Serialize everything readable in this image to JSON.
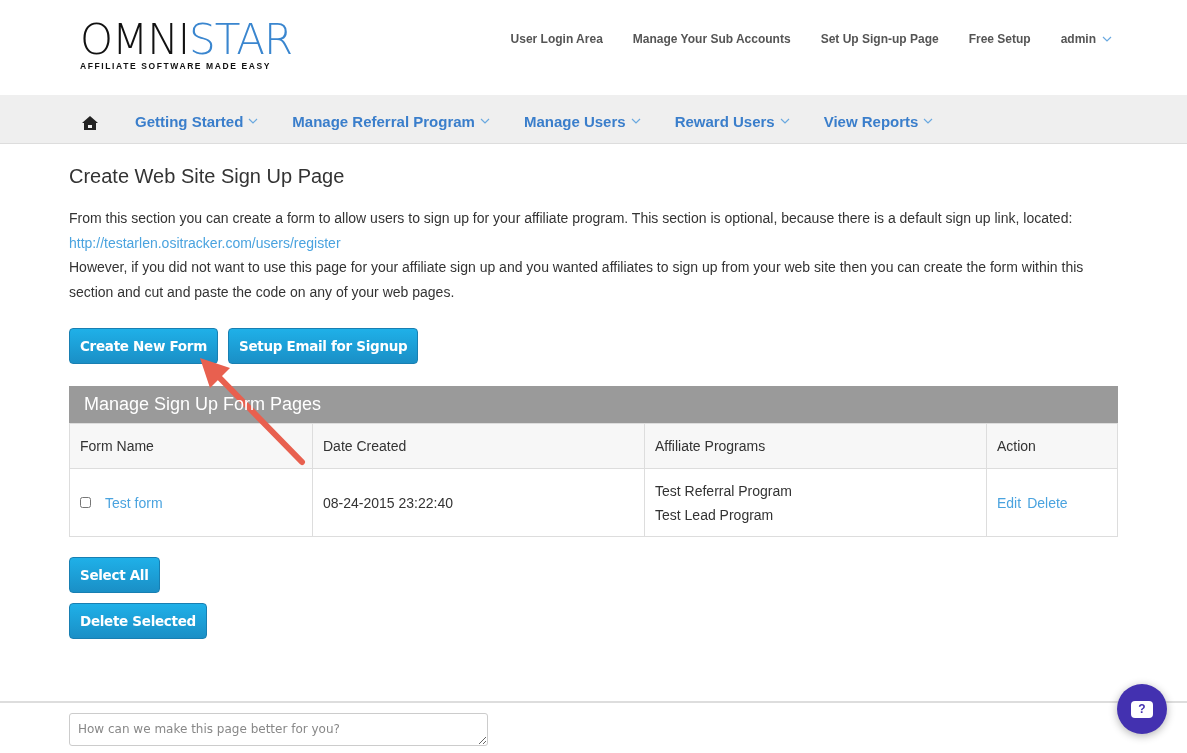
{
  "logo": {
    "word_start": "OMNI",
    "word_end": "STAR",
    "tagline": "AFFILIATE SOFTWARE MADE EASY"
  },
  "top_links": [
    {
      "label": "User Login Area",
      "dropdown": false
    },
    {
      "label": "Manage Your Sub Accounts",
      "dropdown": false
    },
    {
      "label": "Set Up Sign-up Page",
      "dropdown": false
    },
    {
      "label": "Free Setup",
      "dropdown": false
    },
    {
      "label": "admin",
      "dropdown": true
    }
  ],
  "nav": [
    "Getting Started",
    "Manage Referral Program",
    "Manage Users",
    "Reward Users",
    "View Reports"
  ],
  "page_title": "Create Web Site Sign Up Page",
  "intro": {
    "text_before": "From this section you can create a form to allow users to sign up for your affiliate program. This section is optional, because there is a default sign up link, located:",
    "link": "http://testarlen.ositracker.com/users/register",
    "text_after": "However, if you did not want to use this page for your affiliate sign up and you wanted affiliates to sign up from your web site then you can create the form within this section and cut and paste the code on any of your web pages."
  },
  "action_buttons": [
    "Create New Form",
    "Setup Email for Signup"
  ],
  "table": {
    "title": "Manage Sign Up Form Pages",
    "columns": [
      "Form Name",
      "Date Created",
      "Affiliate Programs",
      "Action"
    ],
    "rows": [
      {
        "checked": false,
        "name": "Test form",
        "date": "08-24-2015 23:22:40",
        "programs": [
          "Test Referral Program",
          "Test Lead Program"
        ],
        "actions": [
          "Edit",
          "Delete"
        ]
      }
    ]
  },
  "bottom_buttons": [
    "Select All",
    "Delete Selected"
  ],
  "feedback": {
    "placeholder": "How can we make this page better for you?"
  },
  "help_button": {
    "label": "?"
  }
}
